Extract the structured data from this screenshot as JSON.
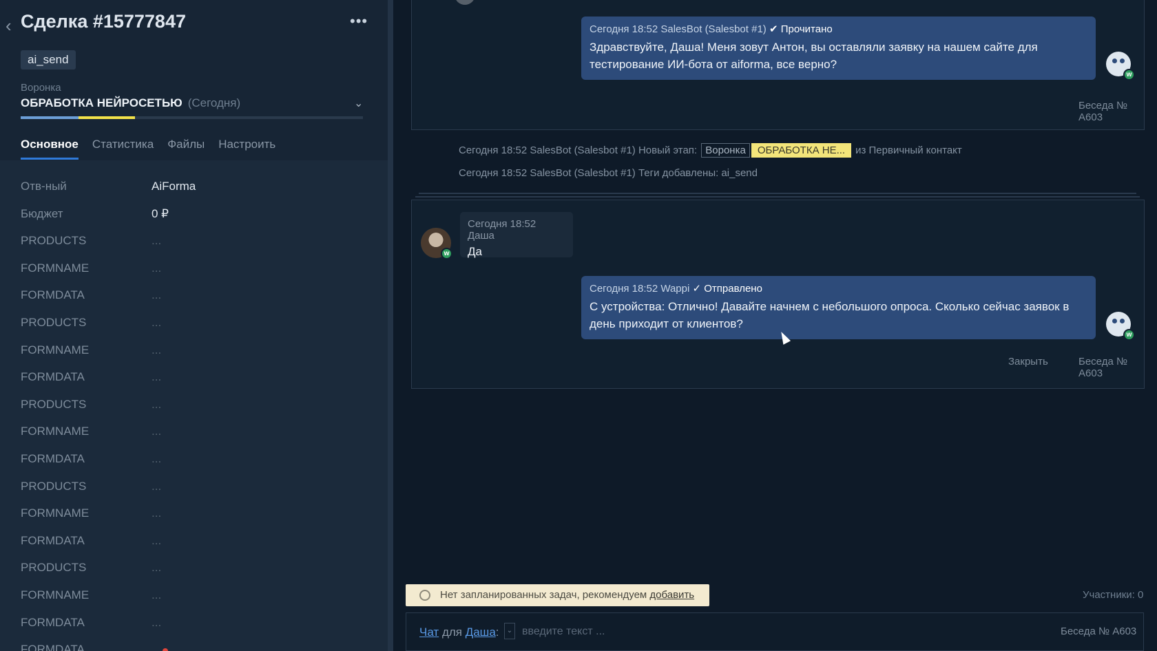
{
  "lead": {
    "title": "Сделка #15777847",
    "tag": "ai_send",
    "funnel_label": "Воронка",
    "funnel_stage": "ОБРАБОТКА НЕЙРОСЕТЬЮ",
    "funnel_date": "(Сегодня)",
    "pipeline_progress": 0.31,
    "colors": {
      "progress_blue": "#6c9fd8",
      "progress_yellow": "#f2e24a",
      "accent": "#2f7ad9"
    }
  },
  "tabs": [
    "Основное",
    "Статистика",
    "Файлы",
    "Настроить"
  ],
  "fields": [
    {
      "name": "Отв-ный",
      "value": "AiForma"
    },
    {
      "name": "Бюджет",
      "value": "0 ₽"
    },
    {
      "name": "PRODUCTS",
      "value": "..."
    },
    {
      "name": "FORMNAME",
      "value": "..."
    },
    {
      "name": "FORMDATA",
      "value": "..."
    },
    {
      "name": "PRODUCTS",
      "value": "..."
    },
    {
      "name": "FORMNAME",
      "value": "..."
    },
    {
      "name": "FORMDATA",
      "value": "..."
    },
    {
      "name": "PRODUCTS",
      "value": "..."
    },
    {
      "name": "FORMNAME",
      "value": "..."
    },
    {
      "name": "FORMDATA",
      "value": "..."
    },
    {
      "name": "PRODUCTS",
      "value": "..."
    },
    {
      "name": "FORMNAME",
      "value": "..."
    },
    {
      "name": "FORMDATA",
      "value": "..."
    },
    {
      "name": "PRODUCTS",
      "value": "..."
    },
    {
      "name": "FORMNAME",
      "value": "..."
    },
    {
      "name": "FORMDATA",
      "value": "..."
    },
    {
      "name": "FORMDATA",
      "value": ""
    }
  ],
  "feed": {
    "msg1": {
      "meta": "Сегодня 18:52 SalesBot (Salesbot #1)",
      "status": "✔ Прочитано",
      "text": "Здравствуйте, Даша! Меня зовут Антон, вы оставляли заявку на нашем сайте для тестирование ИИ-бота от aiforma, все верно?"
    },
    "conv_label": "Беседа № A603",
    "sys1": {
      "prefix": "Сегодня 18:52 SalesBot (Salesbot #1) Новый этап:",
      "pill_funnel": "Воронка",
      "pill_stage": "ОБРАБОТКА НЕ...",
      "suffix": "из Первичный контакт"
    },
    "sys2": "Сегодня 18:52 SalesBot (Salesbot #1) Теги добавлены: ai_send",
    "msg2": {
      "meta": "Сегодня 18:52 Даша",
      "text": "Да"
    },
    "msg3": {
      "meta": "Сегодня 18:52 Wappi",
      "status": "✓ Отправлено",
      "text": "С устройства: Отлично! Давайте начнем с небольшого опроса. Сколько сейчас заявок в день приходит от клиентов?"
    },
    "close_label": "Закрыть"
  },
  "bottom": {
    "task_text": "Нет запланированных задач, рекомендуем",
    "task_link": "добавить",
    "participants": "Участники: 0",
    "chat_link": "Чат",
    "for_word": "для",
    "recipient": "Даша",
    "colon": ":",
    "placeholder": "введите текст ...",
    "conv": "Беседа № A603"
  },
  "icons": [
    "back-arrow-icon",
    "more-icon",
    "chevron-down-icon",
    "bot-avatar-icon",
    "whatsapp-badge-icon",
    "user-avatar-icon",
    "clock-icon",
    "dropdown-icon",
    "mouse-cursor-icon"
  ]
}
